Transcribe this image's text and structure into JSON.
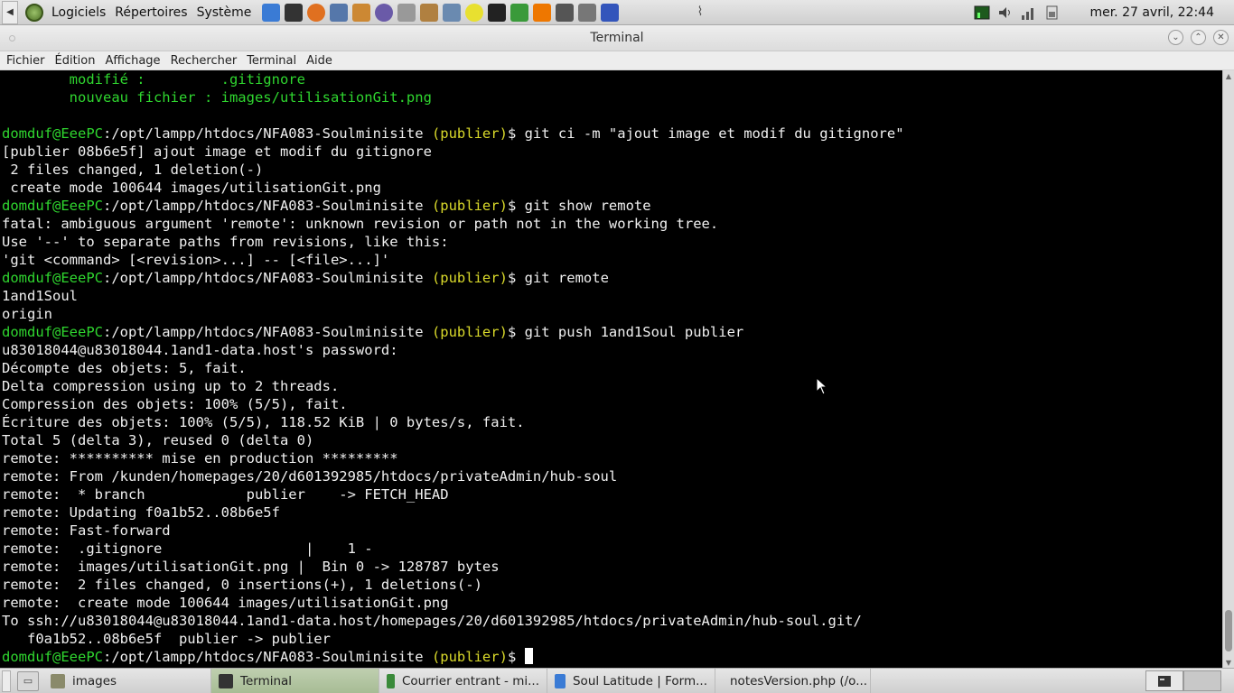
{
  "top_panel": {
    "menus": [
      "Logiciels",
      "Répertoires",
      "Système"
    ],
    "launchers": [
      "chrome-icon",
      "piano-icon",
      "drop-icon",
      "calculator-icon",
      "text-editor-icon",
      "disc-icon",
      "search-icon",
      "package-icon",
      "tools-icon",
      "sun-icon",
      "terminal-icon",
      "refresh-icon",
      "vlc-icon",
      "pencil-icon",
      "printer-icon",
      "firefox-icon"
    ],
    "clock": "mer. 27 avril, 22:44"
  },
  "window": {
    "title": "Terminal"
  },
  "menubar": [
    "Fichier",
    "Édition",
    "Affichage",
    "Rechercher",
    "Terminal",
    "Aide"
  ],
  "terminal": {
    "prompt_user": "domduf@EeePC",
    "prompt_path": ":/opt/lampp/htdocs/NFA083-Soulminisite ",
    "prompt_branch": "(publier)",
    "lines": [
      {
        "g": "        modifié :         .gitignore"
      },
      {
        "g": "        nouveau fichier : images/utilisationGit.png"
      },
      {
        "t": ""
      },
      {
        "p": true,
        "cmd": "$ git ci -m \"ajout image et modif du gitignore\""
      },
      {
        "t": "[publier 08b6e5f] ajout image et modif du gitignore"
      },
      {
        "t": " 2 files changed, 1 deletion(-)"
      },
      {
        "t": " create mode 100644 images/utilisationGit.png"
      },
      {
        "p": true,
        "cmd": "$ git show remote"
      },
      {
        "t": "fatal: ambiguous argument 'remote': unknown revision or path not in the working tree."
      },
      {
        "t": "Use '--' to separate paths from revisions, like this:"
      },
      {
        "t": "'git <command> [<revision>...] -- [<file>...]'"
      },
      {
        "p": true,
        "cmd": "$ git remote"
      },
      {
        "t": "1and1Soul"
      },
      {
        "t": "origin"
      },
      {
        "p": true,
        "cmd": "$ git push 1and1Soul publier"
      },
      {
        "t": "u83018044@u83018044.1and1-data.host's password:"
      },
      {
        "t": "Décompte des objets: 5, fait."
      },
      {
        "t": "Delta compression using up to 2 threads."
      },
      {
        "t": "Compression des objets: 100% (5/5), fait."
      },
      {
        "t": "Écriture des objets: 100% (5/5), 118.52 KiB | 0 bytes/s, fait."
      },
      {
        "t": "Total 5 (delta 3), reused 0 (delta 0)"
      },
      {
        "t": "remote: ********** mise en production *********"
      },
      {
        "t": "remote: From /kunden/homepages/20/d601392985/htdocs/privateAdmin/hub-soul"
      },
      {
        "t": "remote:  * branch            publier    -> FETCH_HEAD"
      },
      {
        "t": "remote: Updating f0a1b52..08b6e5f"
      },
      {
        "t": "remote: Fast-forward"
      },
      {
        "t": "remote:  .gitignore                 |    1 -"
      },
      {
        "t": "remote:  images/utilisationGit.png |  Bin 0 -> 128787 bytes"
      },
      {
        "t": "remote:  2 files changed, 0 insertions(+), 1 deletions(-)"
      },
      {
        "t": "remote:  create mode 100644 images/utilisationGit.png"
      },
      {
        "t": "To ssh://u83018044@u83018044.1and1-data.host/homepages/20/d601392985/htdocs/privateAdmin/hub-soul.git/"
      },
      {
        "t": "   f0a1b52..08b6e5f  publier -> publier"
      },
      {
        "p": true,
        "cmd": "$ ",
        "cursor": true
      }
    ]
  },
  "taskbar": {
    "tasks": [
      {
        "label": "images",
        "icon": "folder-icon",
        "active": false
      },
      {
        "label": "Terminal",
        "icon": "terminal-icon",
        "active": true
      },
      {
        "label": "Courrier entrant - mi...",
        "icon": "mail-icon",
        "active": false
      },
      {
        "label": "Soul Latitude | Form...",
        "icon": "chrome-icon",
        "active": false
      },
      {
        "label": "notesVersion.php (/o...",
        "icon": "text-editor-icon",
        "active": false
      }
    ]
  },
  "colors": {
    "prompt_green": "#2fd62f",
    "branch_yellow": "#d9d92a",
    "terminal_bg": "#000000",
    "active_task": "#b3c6a2"
  }
}
